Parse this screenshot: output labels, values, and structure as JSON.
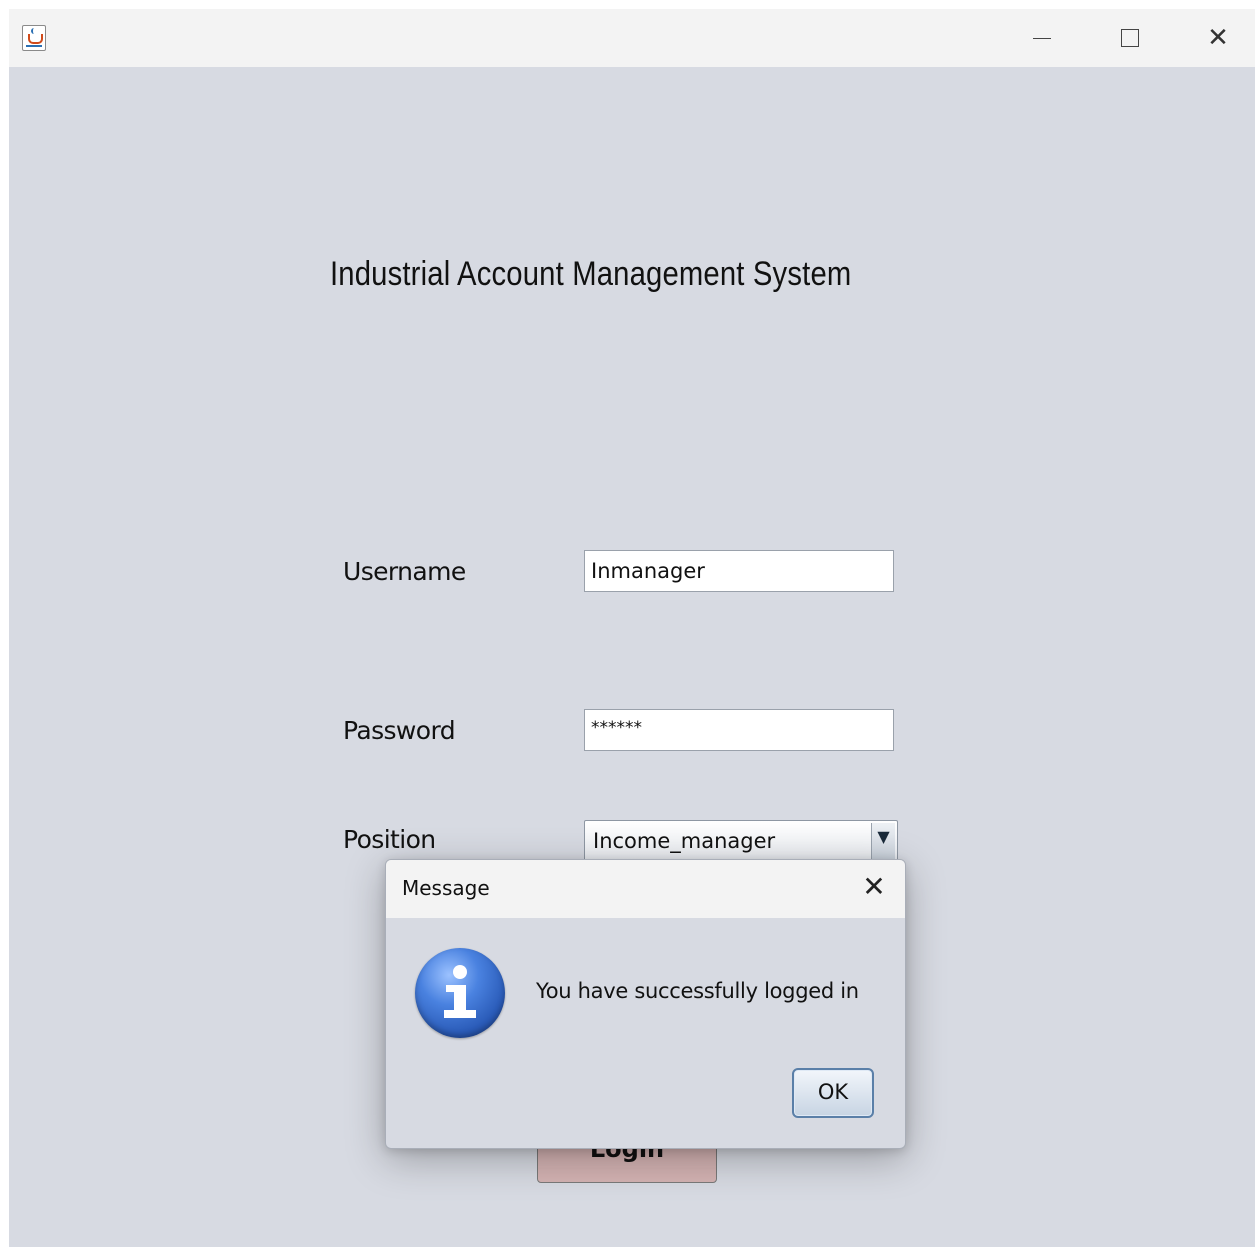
{
  "app": {
    "title": "Industrial Account Management System",
    "window_controls": {
      "minimize": "—",
      "maximize": "",
      "close": "✕"
    }
  },
  "form": {
    "username_label": "Username",
    "username_value": "Inmanager",
    "password_label": "Password",
    "password_value": "******",
    "position_label": "Position",
    "position_selected": "Income_manager",
    "combo_arrow": "▼",
    "login_label": "Login"
  },
  "dialog": {
    "title": "Message",
    "close_glyph": "✕",
    "message": "You have successfully logged in",
    "ok_label": "OK",
    "icon": "info-icon"
  },
  "colors": {
    "window_bg": "#d7dae2",
    "titlebar_bg": "#f3f3f3",
    "login_button_bg": "#d4b3b3",
    "info_icon_blue": "#2a5bb8"
  }
}
